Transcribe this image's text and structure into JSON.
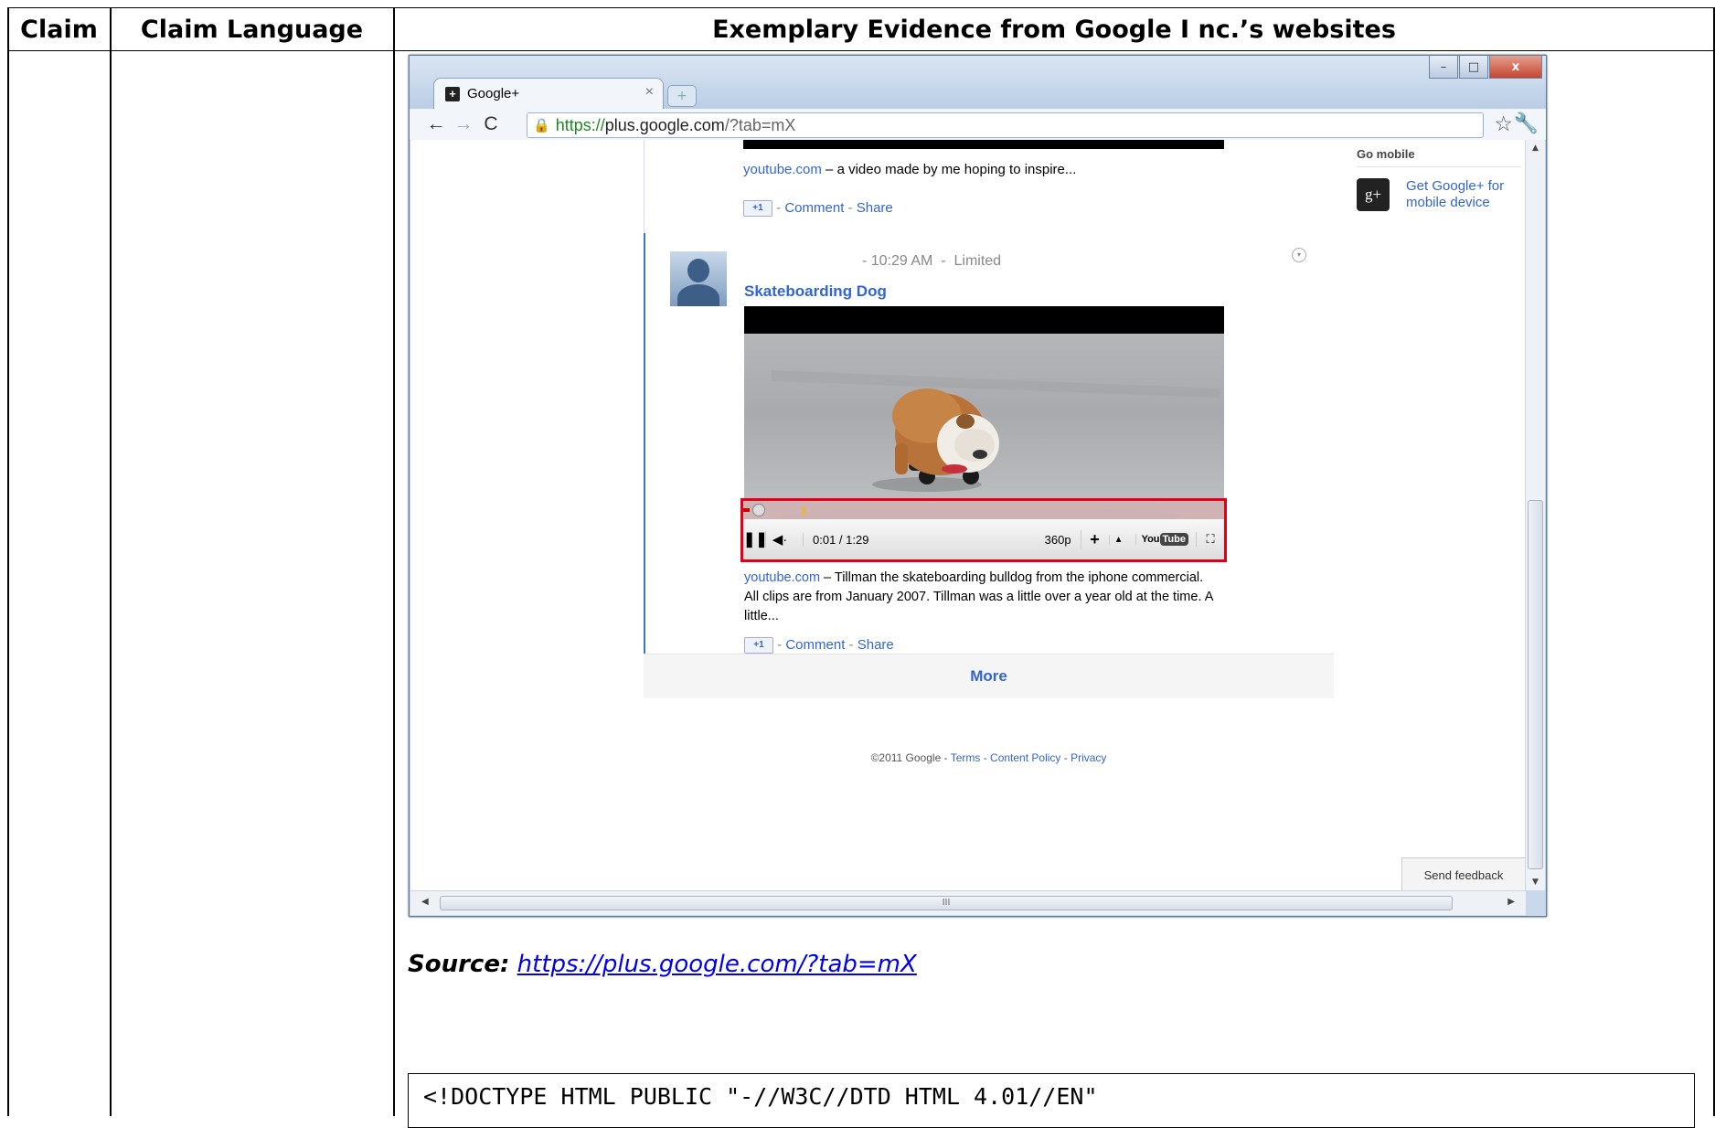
{
  "table": {
    "headers": [
      "Claim",
      "Claim Language",
      "Exemplary Evidence from Google I nc.’s websites"
    ]
  },
  "browser": {
    "tab_title": "Google+",
    "tab_close": "×",
    "new_tab": "+",
    "window_buttons": {
      "minimize": "–",
      "maximize": "□",
      "close": "x"
    },
    "url_scheme": "https://",
    "url_host": "plus.google.com",
    "url_path": "/?tab=mX"
  },
  "page": {
    "top_post": {
      "link": "youtube.com",
      "snippet": " – a video made by me hoping to inspire...",
      "plusone": "+1",
      "comment": "Comment",
      "share": "Share"
    },
    "sidebar": {
      "heading": "Go mobile",
      "promo_icon": "g+",
      "promo_text": "Get Google+ for mobile device"
    },
    "post": {
      "meta": "- 10:29 AM  -  Limited",
      "title": "Skateboarding Dog",
      "player": {
        "time": "0:01 / 1:29",
        "quality": "360p",
        "brand_you": "You",
        "brand_tube": "Tube",
        "progress_fraction": 0.013
      },
      "link": "youtube.com",
      "description": " – Tillman the skateboarding bulldog from the iphone commercial. All clips are from January 2007. Tillman was a little over a year old at the time. A little...",
      "plusone": "+1",
      "comment": "Comment",
      "share": "Share"
    },
    "more": "More",
    "footer": {
      "copyright": "©2011 Google - ",
      "terms": "Terms",
      "content_policy": "Content Policy",
      "privacy": "Privacy"
    },
    "send_feedback": "Send feedback",
    "hscroll_label": "III"
  },
  "source": {
    "label": "Source:",
    "url": "https://plus.google.com/?tab=mX"
  },
  "code": {
    "line1": "<!DOCTYPE HTML PUBLIC \"-//W3C//DTD HTML 4.01//EN\""
  },
  "colors": {
    "link": "#3366cc",
    "highlight_box": "#e0001a",
    "post_border": "#3b78c7"
  }
}
